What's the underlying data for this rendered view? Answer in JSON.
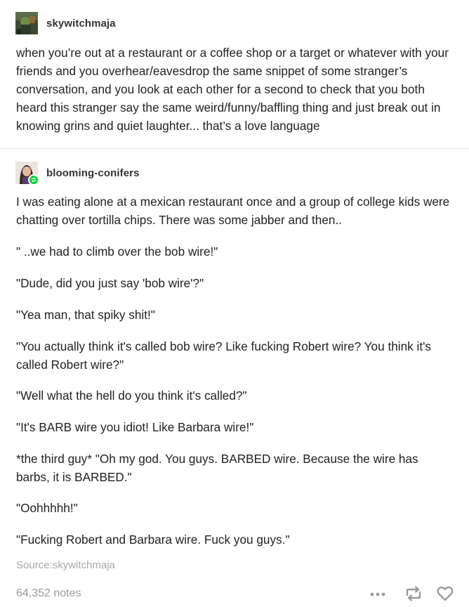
{
  "original_post": {
    "username": "skywitchmaja",
    "avatar_icon": "avatar-image",
    "text": "when you’re out at a restaurant or a coffee shop or a target or whatever with your friends and you overhear/eavesdrop the same snippet of some stranger’s conversation, and you look at each other for a second to check that you both heard this stranger say the same weird/funny/baffling thing and just break out in knowing grins and quiet laughter... that’s a love language"
  },
  "reblog": {
    "username": "blooming-conifers",
    "avatar_icon": "avatar-image",
    "badge_icon": "reblog-badge-icon",
    "badge_color": "#00cf35",
    "paragraphs": [
      "I was eating alone at a mexican restaurant once and a group of college kids were chatting over tortilla chips. There was some jabber and then..",
      "\" ..we had to climb over the bob wire!\"",
      "\"Dude, did you just say 'bob wire'?\"",
      "\"Yea man, that spiky shit!\"",
      "\"You actually think it's called bob wire? Like fucking Robert wire? You think it's called Robert wire?\"",
      "\"Well what the hell do you think it's called?\"",
      "\"It's BARB wire you idiot! Like Barbara wire!\"",
      "*the third guy* \"Oh my god. You guys. BARBED wire. Because the wire has barbs, it is BARBED.\"",
      "\"Oohhhhh!\"",
      "\"Fucking Robert and Barbara wire. Fuck you guys.\""
    ]
  },
  "source": {
    "label": "Source:",
    "name": "skywitchmaja"
  },
  "footer": {
    "notes": "64,352 notes",
    "icons": [
      "more-dots-icon",
      "reblog-icon",
      "like-heart-icon"
    ]
  }
}
